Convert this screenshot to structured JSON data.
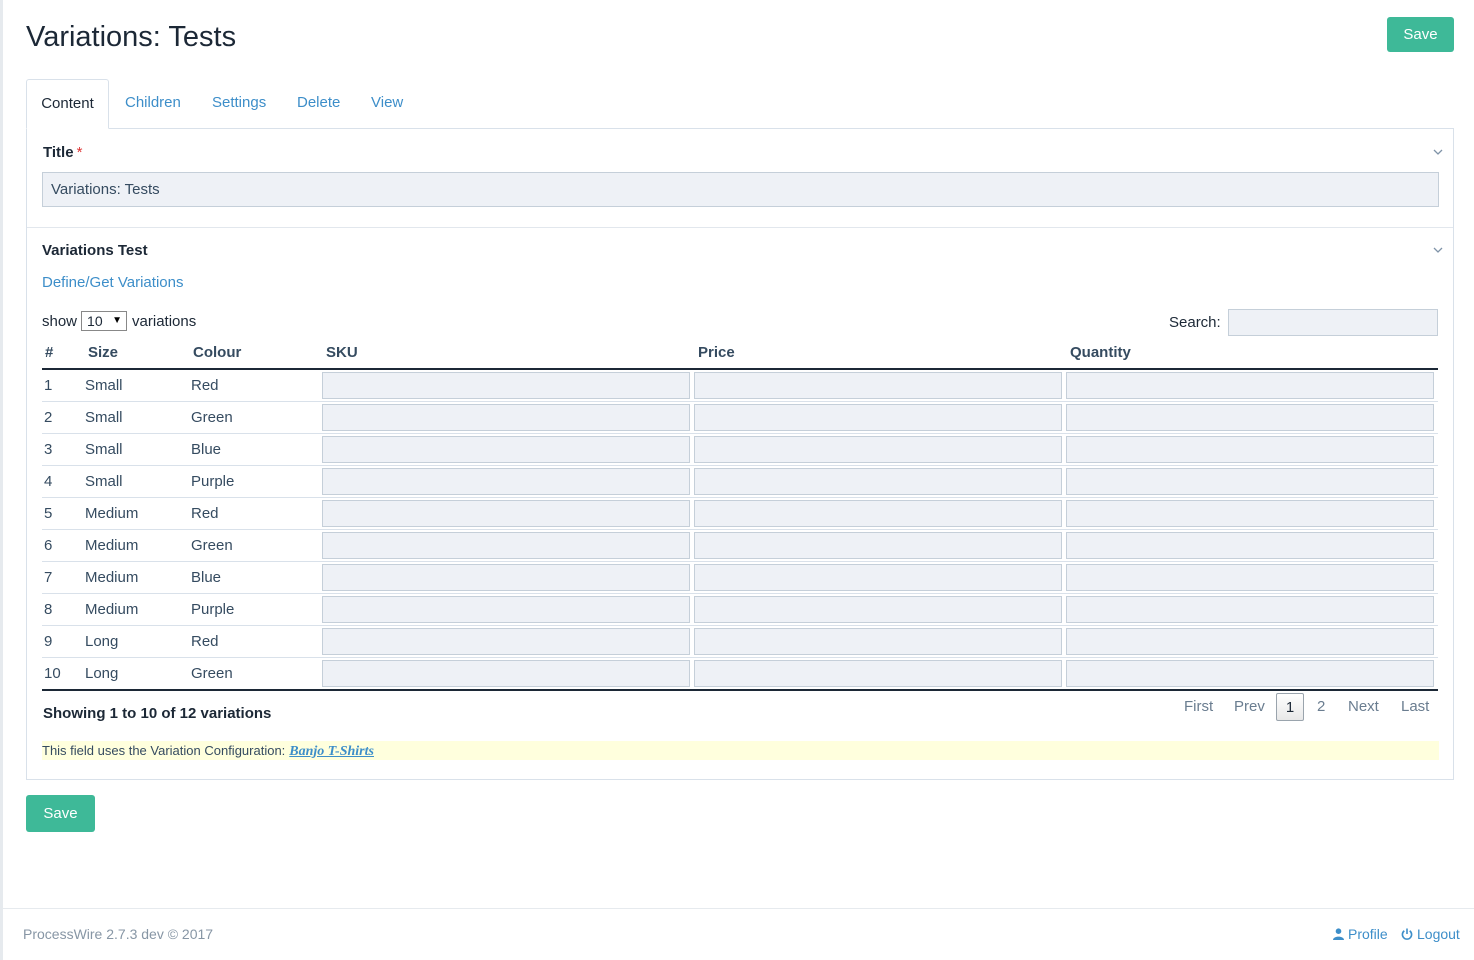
{
  "page": {
    "title": "Variations: Tests",
    "save_label": "Save"
  },
  "tabs": [
    {
      "label": "Content",
      "active": true
    },
    {
      "label": "Children"
    },
    {
      "label": "Settings"
    },
    {
      "label": "Delete"
    },
    {
      "label": "View"
    }
  ],
  "title_field": {
    "label": "Title",
    "required_marker": "*",
    "value": "Variations: Tests"
  },
  "variations_field": {
    "label": "Variations Test",
    "define_link": "Define/Get Variations",
    "show_prefix": "show",
    "show_value": "10",
    "show_suffix": "variations",
    "search_label": "Search:",
    "search_value": "",
    "columns": [
      "#",
      "Size",
      "Colour",
      "SKU",
      "Price",
      "Quantity"
    ],
    "rows": [
      {
        "num": "1",
        "size": "Small",
        "colour": "Red"
      },
      {
        "num": "2",
        "size": "Small",
        "colour": "Green"
      },
      {
        "num": "3",
        "size": "Small",
        "colour": "Blue"
      },
      {
        "num": "4",
        "size": "Small",
        "colour": "Purple"
      },
      {
        "num": "5",
        "size": "Medium",
        "colour": "Red"
      },
      {
        "num": "6",
        "size": "Medium",
        "colour": "Green"
      },
      {
        "num": "7",
        "size": "Medium",
        "colour": "Blue"
      },
      {
        "num": "8",
        "size": "Medium",
        "colour": "Purple"
      },
      {
        "num": "9",
        "size": "Long",
        "colour": "Red"
      },
      {
        "num": "10",
        "size": "Long",
        "colour": "Green"
      }
    ],
    "showing_text": "Showing 1 to 10 of 12 variations",
    "pager": {
      "first": "First",
      "prev": "Prev",
      "pages": [
        "1",
        "2"
      ],
      "current_page": "1",
      "next": "Next",
      "last": "Last"
    },
    "notice_text": "This field uses the Variation Configuration:",
    "notice_link": "Banjo T-Shirts"
  },
  "footer": {
    "copyright": "ProcessWire 2.7.3 dev © 2017",
    "profile_label": "Profile",
    "logout_label": "Logout"
  },
  "colors": {
    "accent": "#3eb998",
    "link": "#3d8ec9",
    "input_bg": "#eef1f6",
    "notice_bg": "#ffffdd"
  }
}
